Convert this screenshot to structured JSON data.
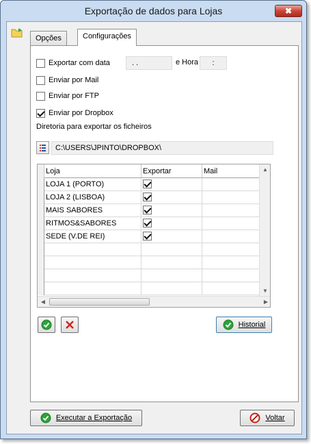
{
  "window": {
    "title": "Exportação de dados para Lojas",
    "close_glyph": "✖"
  },
  "tabs": [
    {
      "label": "Opções",
      "active": false
    },
    {
      "label": "Configurações",
      "active": true
    }
  ],
  "options": {
    "export_with_date": {
      "label": "Exportar com data",
      "checked": false,
      "date_value": " . .",
      "hour_label": "e Hora",
      "hour_value": ":"
    },
    "send_mail": {
      "label": "Enviar por Mail",
      "checked": false
    },
    "send_ftp": {
      "label": "Enviar por FTP",
      "checked": false
    },
    "send_dropbox": {
      "label": "Enviar por Dropbox",
      "checked": true
    }
  },
  "directory": {
    "label": "Diretoria para exportar os ficheiros",
    "value": "C:\\USERS\\JPINTO\\DROPBOX\\",
    "button_icon": "list-icon"
  },
  "grid": {
    "columns": [
      "Loja",
      "Exportar",
      "Mail"
    ],
    "rows": [
      {
        "loja": "LOJA 1 (PORTO)",
        "exportar": true,
        "mail": ""
      },
      {
        "loja": "LOJA 2 (LISBOA)",
        "exportar": true,
        "mail": ""
      },
      {
        "loja": "MAIS SABORES",
        "exportar": true,
        "mail": ""
      },
      {
        "loja": "RITMOS&SABORES",
        "exportar": true,
        "mail": ""
      },
      {
        "loja": "SEDE (V.DE REI)",
        "exportar": true,
        "mail": ""
      }
    ],
    "empty_rows": 4
  },
  "buttons": {
    "confirm_icon": "green-check-icon",
    "cancel_icon": "red-x-icon",
    "historial_label": "Historial",
    "export_label": "Executar a Exportação",
    "back_label": "Voltar"
  },
  "colors": {
    "green": "#2ea33a",
    "red": "#d2231c"
  }
}
